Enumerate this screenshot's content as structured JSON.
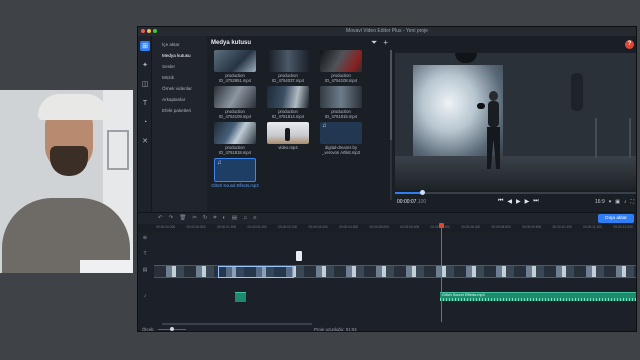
{
  "window": {
    "title": "Movavi Video Editor Plus - Yeni proje"
  },
  "toolstrip": {
    "icons": [
      "import-icon",
      "magic-wand-icon",
      "transitions-icon",
      "titles-icon",
      "stickers-icon",
      "tools-icon"
    ]
  },
  "categories": [
    "İçe aktar",
    "Medya kutusu",
    "Sesler",
    "Müzik",
    "Örnek videolar",
    "Arkaplanlar",
    "Efekt paketleri"
  ],
  "media": {
    "title": "Medya kutusu",
    "items": [
      {
        "label": "production ID_4753951.mp4"
      },
      {
        "label": "production ID_4754037.mp4"
      },
      {
        "label": "production ID_4754108.mp4"
      },
      {
        "label": "production ID_4754109.mp4"
      },
      {
        "label": "production ID_4761814.mp4"
      },
      {
        "label": "production ID_4761815.mp4"
      },
      {
        "label": "production ID_4761818.mp4"
      },
      {
        "label": "video.mp4"
      },
      {
        "label": "digital-dreams by _verovon Artlist.mp3"
      },
      {
        "label": "Glitch Sound Effects.mp3"
      }
    ]
  },
  "preview": {
    "timecode": "00:00:07",
    "timecode_frames": ".100",
    "aspect": "16:9",
    "progress": 0.11,
    "help": "?"
  },
  "timeline": {
    "export_label": "Dışa aktar",
    "ruler": [
      "00:00:00.000",
      "00:00:00.800",
      "00:00:01.600",
      "00:00:02.400",
      "00:00:03.200",
      "00:00:04.000",
      "00:00:04.800",
      "00:00:05.600",
      "00:00:06.400",
      "00:00:07.200",
      "00:00:08.000",
      "00:00:08.800",
      "00:00:09.600",
      "00:00:10.400",
      "00:00:11.200",
      "00:00:12.000"
    ],
    "audio_clip_label": "Glitch Sound Effects.mp3",
    "scale_label": "Ölçek:",
    "duration_label": "Proje uzunluğu:",
    "duration_value": "01:04"
  }
}
